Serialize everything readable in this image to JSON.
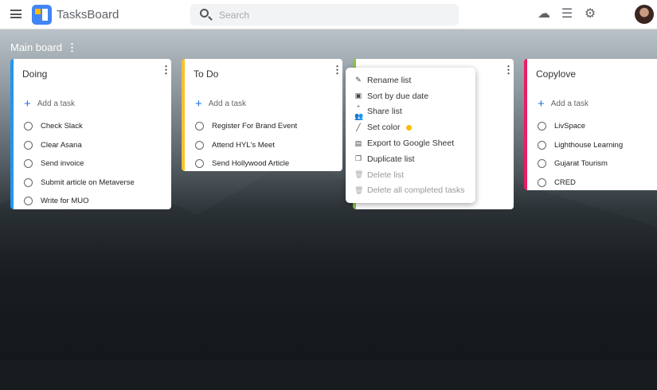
{
  "header": {
    "app_title": "TasksBoard",
    "search_placeholder": "Search"
  },
  "board": {
    "title": "Main board"
  },
  "lists": [
    {
      "title": "Doing",
      "color": "#2196f3",
      "add_label": "Add a task",
      "tasks": [
        "Check Slack",
        "Clear Asana",
        "Send invoice",
        "Submit article on Metaverse",
        "Write for MUO"
      ]
    },
    {
      "title": "To Do",
      "color": "#fbc02d",
      "add_label": "Add a task",
      "tasks": [
        "Register For Brand Event",
        "Attend HYL's Meet",
        "Send Hollywood Article"
      ]
    },
    {
      "title": "",
      "color": "#8bc34a"
    },
    {
      "title": "Copylove",
      "color": "#e91e63",
      "add_label": "Add a task",
      "tasks": [
        "LivSpace",
        "Lighthouse Learning",
        "Gujarat Tourism",
        "CRED"
      ]
    }
  ],
  "context_menu": {
    "items": [
      {
        "label": "Rename list",
        "icon": "pencil-icon"
      },
      {
        "label": "Sort by due date",
        "icon": "calendar-icon"
      },
      {
        "label": "Share list",
        "icon": "share-people-icon"
      },
      {
        "label": "Set color",
        "icon": "brush-icon",
        "color": "#fbbc04"
      },
      {
        "label": "Export to Google Sheet",
        "icon": "sheet-icon"
      },
      {
        "label": "Duplicate list",
        "icon": "copy-icon"
      },
      {
        "label": "Delete list",
        "icon": "trash-icon",
        "disabled": true
      },
      {
        "label": "Delete all completed tasks",
        "icon": "trash-list-icon",
        "disabled": true
      }
    ]
  }
}
